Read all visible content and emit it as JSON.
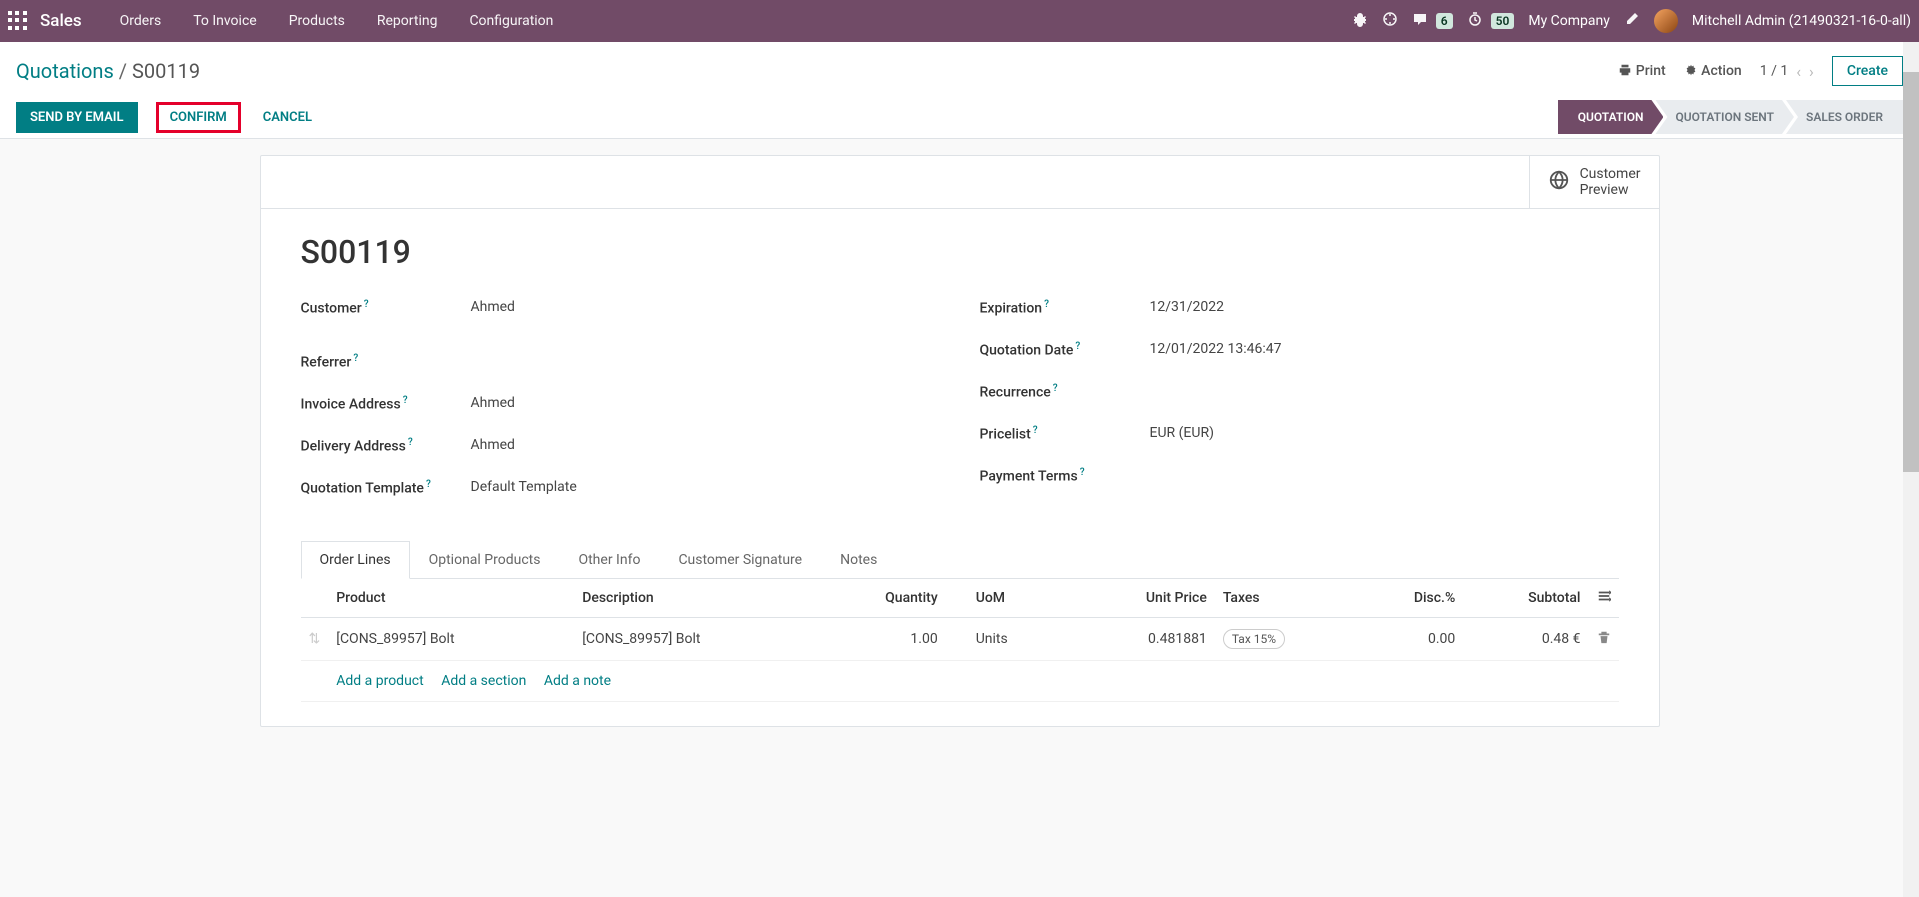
{
  "navbar": {
    "brand": "Sales",
    "links": [
      "Orders",
      "To Invoice",
      "Products",
      "Reporting",
      "Configuration"
    ],
    "chat_badge": "6",
    "timer_badge": "50",
    "company": "My Company",
    "username": "Mitchell Admin (21490321-16-0-all)"
  },
  "breadcrumb": {
    "parent": "Quotations",
    "current": "S00119"
  },
  "control": {
    "print": "Print",
    "action": "Action",
    "pager": "1 / 1",
    "create": "Create"
  },
  "buttons": {
    "send_email": "SEND BY EMAIL",
    "confirm": "CONFIRM",
    "cancel": "CANCEL"
  },
  "status_steps": [
    "QUOTATION",
    "QUOTATION SENT",
    "SALES ORDER"
  ],
  "customer_preview": "Customer\nPreview",
  "record": {
    "title": "S00119",
    "left": [
      {
        "label": "Customer",
        "value": "Ahmed"
      },
      {
        "label": "Referrer",
        "value": ""
      },
      {
        "label": "Invoice Address",
        "value": "Ahmed"
      },
      {
        "label": "Delivery Address",
        "value": "Ahmed"
      },
      {
        "label": "Quotation Template",
        "value": "Default Template"
      }
    ],
    "right": [
      {
        "label": "Expiration",
        "value": "12/31/2022"
      },
      {
        "label": "Quotation Date",
        "value": "12/01/2022 13:46:47"
      },
      {
        "label": "Recurrence",
        "value": ""
      },
      {
        "label": "Pricelist",
        "value": "EUR (EUR)"
      },
      {
        "label": "Payment Terms",
        "value": ""
      }
    ]
  },
  "tabs": [
    "Order Lines",
    "Optional Products",
    "Other Info",
    "Customer Signature",
    "Notes"
  ],
  "table": {
    "headers": {
      "product": "Product",
      "description": "Description",
      "quantity": "Quantity",
      "uom": "UoM",
      "unit_price": "Unit Price",
      "taxes": "Taxes",
      "disc": "Disc.%",
      "subtotal": "Subtotal"
    },
    "rows": [
      {
        "product": "[CONS_89957] Bolt",
        "description": "[CONS_89957] Bolt",
        "quantity": "1.00",
        "uom": "Units",
        "unit_price": "0.481881",
        "taxes": "Tax 15%",
        "disc": "0.00",
        "subtotal": "0.48 €"
      }
    ],
    "add_product": "Add a product",
    "add_section": "Add a section",
    "add_note": "Add a note"
  }
}
